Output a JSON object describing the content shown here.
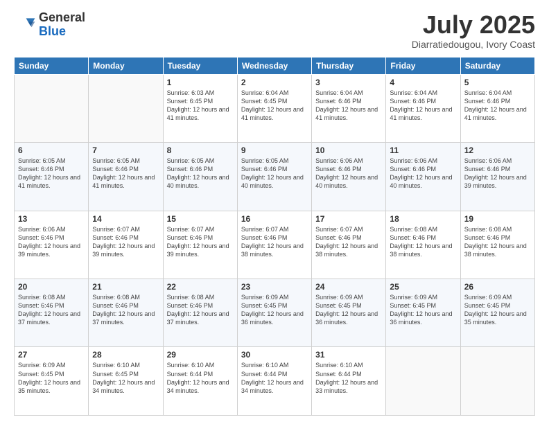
{
  "logo": {
    "general": "General",
    "blue": "Blue"
  },
  "header": {
    "month": "July 2025",
    "location": "Diarratiedougou, Ivory Coast"
  },
  "weekdays": [
    "Sunday",
    "Monday",
    "Tuesday",
    "Wednesday",
    "Thursday",
    "Friday",
    "Saturday"
  ],
  "weeks": [
    [
      {
        "day": "",
        "info": ""
      },
      {
        "day": "",
        "info": ""
      },
      {
        "day": "1",
        "info": "Sunrise: 6:03 AM\nSunset: 6:45 PM\nDaylight: 12 hours and 41 minutes."
      },
      {
        "day": "2",
        "info": "Sunrise: 6:04 AM\nSunset: 6:45 PM\nDaylight: 12 hours and 41 minutes."
      },
      {
        "day": "3",
        "info": "Sunrise: 6:04 AM\nSunset: 6:46 PM\nDaylight: 12 hours and 41 minutes."
      },
      {
        "day": "4",
        "info": "Sunrise: 6:04 AM\nSunset: 6:46 PM\nDaylight: 12 hours and 41 minutes."
      },
      {
        "day": "5",
        "info": "Sunrise: 6:04 AM\nSunset: 6:46 PM\nDaylight: 12 hours and 41 minutes."
      }
    ],
    [
      {
        "day": "6",
        "info": "Sunrise: 6:05 AM\nSunset: 6:46 PM\nDaylight: 12 hours and 41 minutes."
      },
      {
        "day": "7",
        "info": "Sunrise: 6:05 AM\nSunset: 6:46 PM\nDaylight: 12 hours and 41 minutes."
      },
      {
        "day": "8",
        "info": "Sunrise: 6:05 AM\nSunset: 6:46 PM\nDaylight: 12 hours and 40 minutes."
      },
      {
        "day": "9",
        "info": "Sunrise: 6:05 AM\nSunset: 6:46 PM\nDaylight: 12 hours and 40 minutes."
      },
      {
        "day": "10",
        "info": "Sunrise: 6:06 AM\nSunset: 6:46 PM\nDaylight: 12 hours and 40 minutes."
      },
      {
        "day": "11",
        "info": "Sunrise: 6:06 AM\nSunset: 6:46 PM\nDaylight: 12 hours and 40 minutes."
      },
      {
        "day": "12",
        "info": "Sunrise: 6:06 AM\nSunset: 6:46 PM\nDaylight: 12 hours and 39 minutes."
      }
    ],
    [
      {
        "day": "13",
        "info": "Sunrise: 6:06 AM\nSunset: 6:46 PM\nDaylight: 12 hours and 39 minutes."
      },
      {
        "day": "14",
        "info": "Sunrise: 6:07 AM\nSunset: 6:46 PM\nDaylight: 12 hours and 39 minutes."
      },
      {
        "day": "15",
        "info": "Sunrise: 6:07 AM\nSunset: 6:46 PM\nDaylight: 12 hours and 39 minutes."
      },
      {
        "day": "16",
        "info": "Sunrise: 6:07 AM\nSunset: 6:46 PM\nDaylight: 12 hours and 38 minutes."
      },
      {
        "day": "17",
        "info": "Sunrise: 6:07 AM\nSunset: 6:46 PM\nDaylight: 12 hours and 38 minutes."
      },
      {
        "day": "18",
        "info": "Sunrise: 6:08 AM\nSunset: 6:46 PM\nDaylight: 12 hours and 38 minutes."
      },
      {
        "day": "19",
        "info": "Sunrise: 6:08 AM\nSunset: 6:46 PM\nDaylight: 12 hours and 38 minutes."
      }
    ],
    [
      {
        "day": "20",
        "info": "Sunrise: 6:08 AM\nSunset: 6:46 PM\nDaylight: 12 hours and 37 minutes."
      },
      {
        "day": "21",
        "info": "Sunrise: 6:08 AM\nSunset: 6:46 PM\nDaylight: 12 hours and 37 minutes."
      },
      {
        "day": "22",
        "info": "Sunrise: 6:08 AM\nSunset: 6:46 PM\nDaylight: 12 hours and 37 minutes."
      },
      {
        "day": "23",
        "info": "Sunrise: 6:09 AM\nSunset: 6:45 PM\nDaylight: 12 hours and 36 minutes."
      },
      {
        "day": "24",
        "info": "Sunrise: 6:09 AM\nSunset: 6:45 PM\nDaylight: 12 hours and 36 minutes."
      },
      {
        "day": "25",
        "info": "Sunrise: 6:09 AM\nSunset: 6:45 PM\nDaylight: 12 hours and 36 minutes."
      },
      {
        "day": "26",
        "info": "Sunrise: 6:09 AM\nSunset: 6:45 PM\nDaylight: 12 hours and 35 minutes."
      }
    ],
    [
      {
        "day": "27",
        "info": "Sunrise: 6:09 AM\nSunset: 6:45 PM\nDaylight: 12 hours and 35 minutes."
      },
      {
        "day": "28",
        "info": "Sunrise: 6:10 AM\nSunset: 6:45 PM\nDaylight: 12 hours and 34 minutes."
      },
      {
        "day": "29",
        "info": "Sunrise: 6:10 AM\nSunset: 6:44 PM\nDaylight: 12 hours and 34 minutes."
      },
      {
        "day": "30",
        "info": "Sunrise: 6:10 AM\nSunset: 6:44 PM\nDaylight: 12 hours and 34 minutes."
      },
      {
        "day": "31",
        "info": "Sunrise: 6:10 AM\nSunset: 6:44 PM\nDaylight: 12 hours and 33 minutes."
      },
      {
        "day": "",
        "info": ""
      },
      {
        "day": "",
        "info": ""
      }
    ]
  ]
}
